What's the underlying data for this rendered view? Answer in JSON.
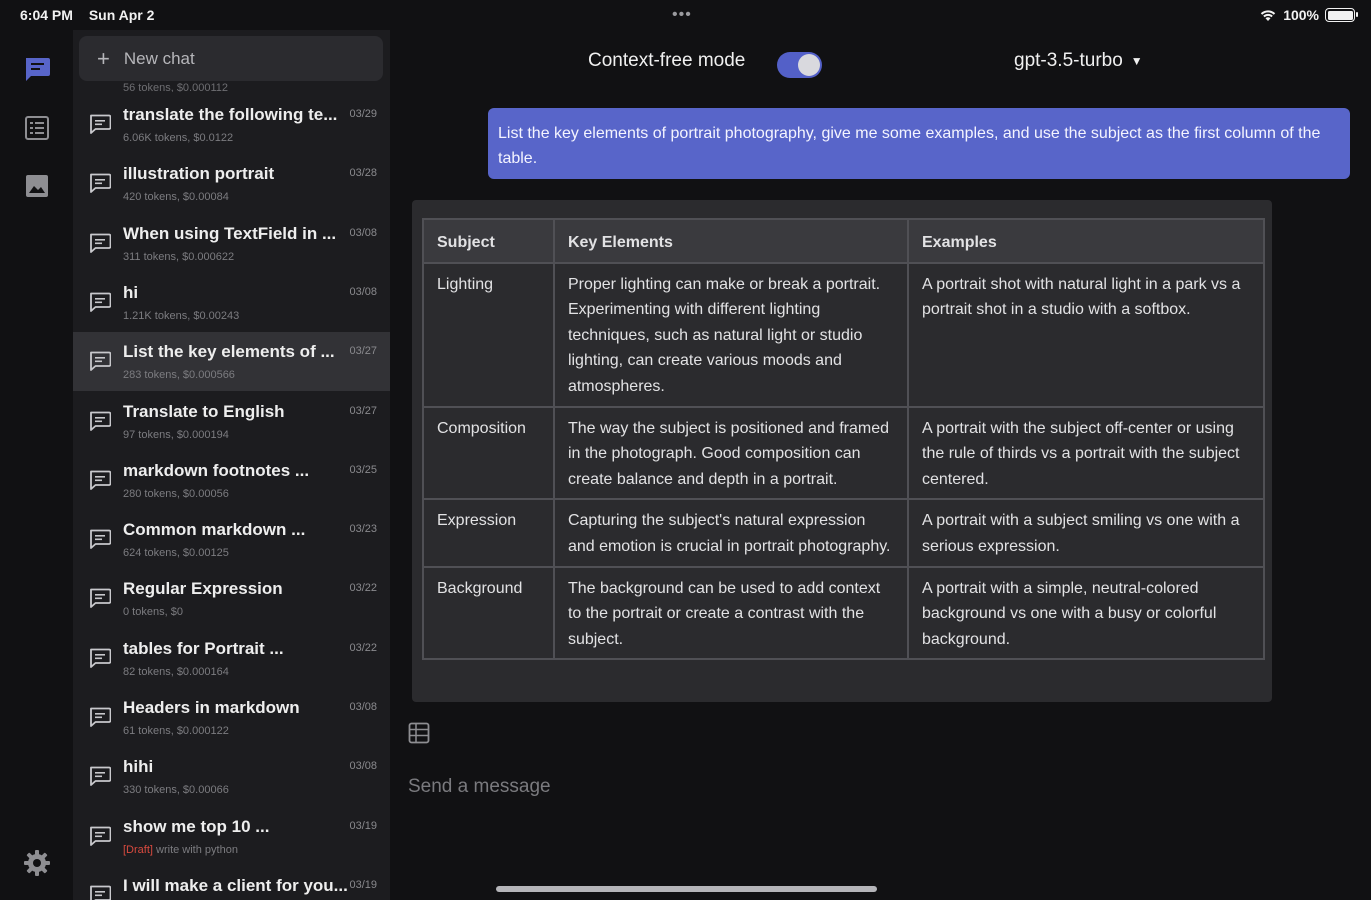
{
  "status": {
    "time": "6:04 PM",
    "date": "Sun Apr 2",
    "dots": "•••",
    "battery": "100%"
  },
  "rail": {
    "icons": [
      "chat-bubble-icon",
      "list-icon",
      "image-icon",
      "gear-icon"
    ],
    "active_color": "#5865c9"
  },
  "sidebar": {
    "new_chat_label": "New chat",
    "partial_top": "56 tokens, $0.000112",
    "items": [
      {
        "title": "translate the following te...",
        "date": "03/29",
        "meta": "6.06K tokens, $0.0122",
        "selected": false
      },
      {
        "title": "illustration portrait",
        "date": "03/28",
        "meta": "420 tokens, $0.00084",
        "selected": false
      },
      {
        "title": "When using TextField in ...",
        "date": "03/08",
        "meta": "311 tokens, $0.000622",
        "selected": false
      },
      {
        "title": "hi",
        "date": "03/08",
        "meta": "1.21K tokens, $0.00243",
        "selected": false
      },
      {
        "title": "List the key elements of ...",
        "date": "03/27",
        "meta": "283 tokens, $0.000566",
        "selected": true
      },
      {
        "title": "Translate to English",
        "date": "03/27",
        "meta": "97 tokens, $0.000194",
        "selected": false
      },
      {
        "title": "markdown footnotes ...",
        "date": "03/25",
        "meta": "280 tokens, $0.00056",
        "selected": false
      },
      {
        "title": "Common markdown ...",
        "date": "03/23",
        "meta": "624 tokens, $0.00125",
        "selected": false
      },
      {
        "title": "Regular Expression",
        "date": "03/22",
        "meta": "0 tokens, $0",
        "selected": false
      },
      {
        "title": "tables for Portrait ...",
        "date": "03/22",
        "meta": "82 tokens, $0.000164",
        "selected": false
      },
      {
        "title": "Headers in markdown",
        "date": "03/08",
        "meta": "61 tokens, $0.000122",
        "selected": false
      },
      {
        "title": "hihi",
        "date": "03/08",
        "meta": "330 tokens, $0.00066",
        "selected": false
      },
      {
        "title": "show me top 10 ...",
        "date": "03/19",
        "meta_draft": "[Draft]",
        "meta": "write with python",
        "selected": false
      },
      {
        "title": "I will make a client for you...",
        "date": "03/19",
        "meta": "",
        "selected": false
      }
    ]
  },
  "topbar": {
    "mode_label": "Context-free mode",
    "mode_on": true,
    "model": "gpt-3.5-turbo"
  },
  "conversation": {
    "user_message": "List the key elements of portrait photography, give me some examples, and use the subject as the first column of the table.",
    "table": {
      "headers": [
        "Subject",
        "Key Elements",
        "Examples"
      ],
      "rows": [
        [
          "Lighting",
          "Proper lighting can make or break a portrait. Experimenting with different lighting techniques, such as natural light or studio lighting, can create various moods and atmospheres.",
          "A portrait shot with natural light in a park vs a portrait shot in a studio with a softbox."
        ],
        [
          "Composition",
          "The way the subject is positioned and framed in the photograph. Good composition can create balance and depth in a portrait.",
          "A portrait with the subject off-center or using the rule of thirds vs a portrait with the subject centered."
        ],
        [
          "Expression",
          "Capturing the subject's natural expression and emotion is crucial in portrait photography.",
          "A portrait with a subject smiling vs one with a serious expression."
        ],
        [
          "Background",
          "The background can be used to add context to the portrait or create a contrast with the subject.",
          "A portrait with a simple, neutral-colored background vs one with a busy or colorful background."
        ]
      ]
    }
  },
  "input": {
    "placeholder": "Send a message"
  },
  "colors": {
    "accent": "#5865c9",
    "draft": "#d84a3f"
  }
}
